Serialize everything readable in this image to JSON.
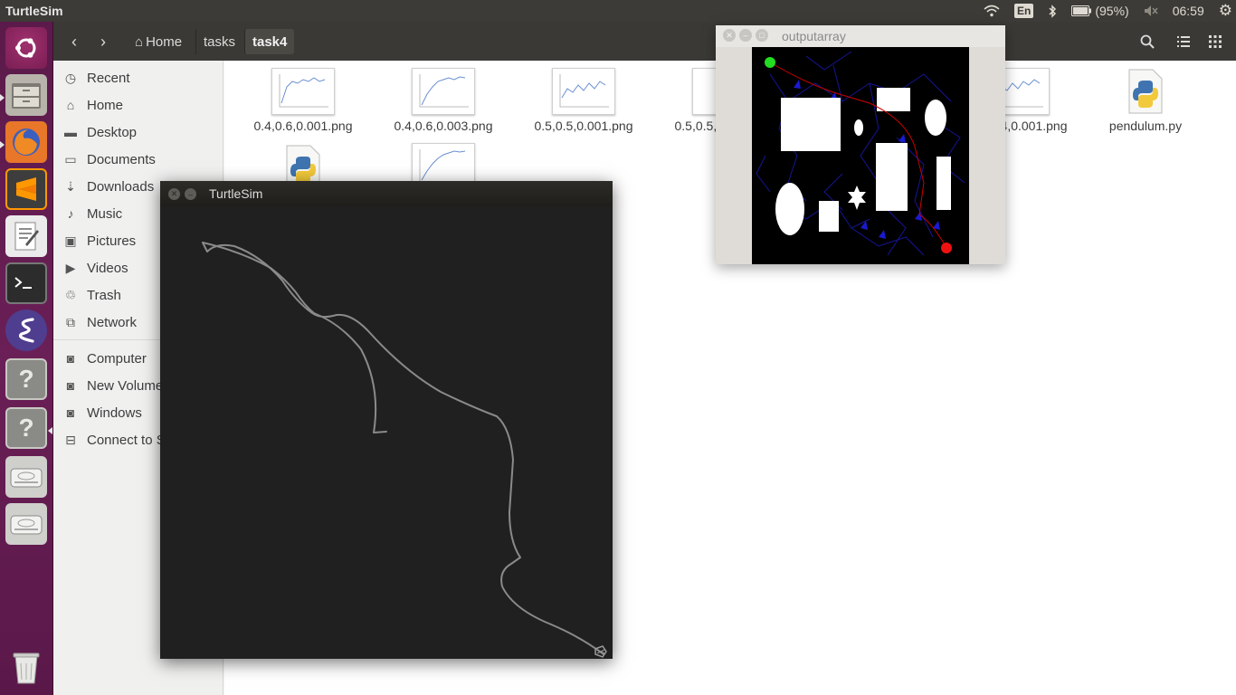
{
  "top_panel": {
    "app_title": "TurtleSim",
    "keyboard_layout": "En",
    "battery_text": "(95%)",
    "clock": "06:59"
  },
  "launcher": {
    "items": [
      {
        "name": "ubuntu-dash-icon"
      },
      {
        "name": "files-icon"
      },
      {
        "name": "firefox-icon"
      },
      {
        "name": "sublime-text-icon"
      },
      {
        "name": "text-editor-icon"
      },
      {
        "name": "terminal-icon"
      },
      {
        "name": "emacs-icon"
      },
      {
        "name": "unknown-app-icon"
      },
      {
        "name": "unknown-app-icon"
      },
      {
        "name": "drive-icon"
      },
      {
        "name": "drive-icon"
      },
      {
        "name": "trash-icon"
      }
    ]
  },
  "header": {
    "breadcrumbs": [
      "Home",
      "tasks",
      "task4"
    ]
  },
  "sidebar": {
    "items": [
      {
        "label": "Recent",
        "icon": "clock-icon"
      },
      {
        "label": "Home",
        "icon": "home-icon"
      },
      {
        "label": "Desktop",
        "icon": "folder-icon"
      },
      {
        "label": "Documents",
        "icon": "folder-icon"
      },
      {
        "label": "Downloads",
        "icon": "download-icon"
      },
      {
        "label": "Music",
        "icon": "music-icon"
      },
      {
        "label": "Pictures",
        "icon": "camera-icon"
      },
      {
        "label": "Videos",
        "icon": "video-icon"
      },
      {
        "label": "Trash",
        "icon": "trash-icon"
      },
      {
        "label": "Network",
        "icon": "network-icon"
      }
    ],
    "devices": [
      {
        "label": "Computer",
        "icon": "drive-icon"
      },
      {
        "label": "New Volume",
        "icon": "drive-icon"
      },
      {
        "label": "Windows",
        "icon": "drive-icon"
      },
      {
        "label": "Connect to Server",
        "icon": "server-icon"
      }
    ]
  },
  "files": [
    {
      "name": "0.4,0.6,0.001.png",
      "type": "image"
    },
    {
      "name": "0.4,0.6,0.003.png",
      "type": "image"
    },
    {
      "name": "0.5,0.5,0.001.png",
      "type": "image"
    },
    {
      "name": "0.5,0.5,0.003.png",
      "type": "image"
    },
    {
      "name": "0.6,0.4,0.001.png",
      "type": "image"
    },
    {
      "name": "pendulum.py",
      "type": "python"
    },
    {
      "name": "",
      "type": "python"
    },
    {
      "name": "",
      "type": "image"
    }
  ],
  "turtlesim_window": {
    "title": "TurtleSim"
  },
  "output_window": {
    "title": "outputarray"
  },
  "colors": {
    "accent_orange": "#e95420",
    "launcher_purple": "#6a1f56",
    "start_marker": "#22dd22",
    "goal_marker": "#ee1111",
    "path_red": "#cc0000",
    "trail_gray": "#8a8a8a"
  }
}
